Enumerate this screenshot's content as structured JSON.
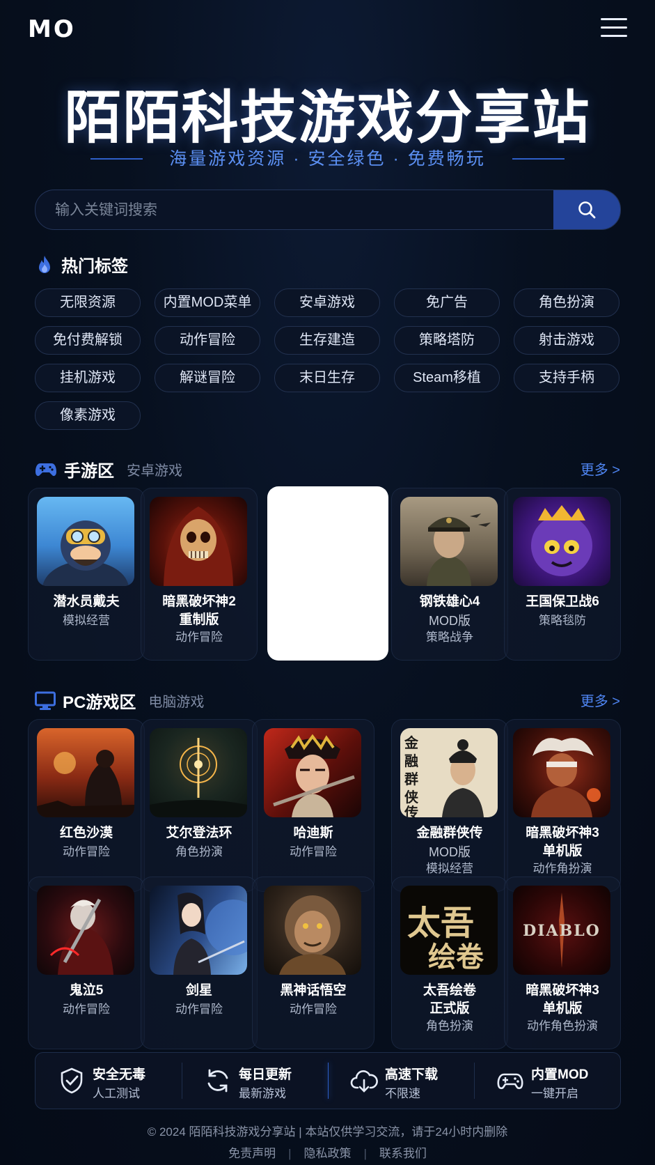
{
  "header": {
    "logo": "MO",
    "menu_icon": "hamburger-menu-icon"
  },
  "hero": {
    "title": "陌陌科技游戏分享站",
    "subtitle": "海量游戏资源 · 安全绿色 · 免费畅玩"
  },
  "search": {
    "placeholder": "输入关键词搜索",
    "icon": "search-icon"
  },
  "hot_tags": {
    "title": "热门标签",
    "icon": "flame-icon",
    "items": [
      "无限资源",
      "内置MOD菜单",
      "安卓游戏",
      "免广告",
      "角色扮演",
      "免付费解锁",
      "动作冒险",
      "生存建造",
      "策略塔防",
      "射击游戏",
      "挂机游戏",
      "解谜冒险",
      "末日生存",
      "Steam移植",
      "支持手柄",
      "像素游戏"
    ]
  },
  "mobile_section": {
    "title": "手游区",
    "subtitle": "安卓游戏",
    "more": "更多 >",
    "icon": "gamepad-icon",
    "cards": [
      {
        "name1": "潜水员戴夫",
        "name2": "",
        "genre": "模拟经营"
      },
      {
        "name1": "暗黑破坏神2",
        "name2": "重制版",
        "genre": "动作冒险"
      },
      {
        "name1": "",
        "name2": "",
        "genre": ""
      },
      {
        "name1": "钢铁雄心4",
        "name2": "MOD版",
        "genre": "策略战争"
      },
      {
        "name1": "王国保卫战6",
        "name2": "",
        "genre": "策略毯防"
      }
    ]
  },
  "pc_section": {
    "title": "PC游戏区",
    "subtitle": "电脑游戏",
    "more": "更多 >",
    "icon": "monitor-icon",
    "row1": [
      {
        "name1": "红色沙漠",
        "name2": "",
        "genre": "动作冒险"
      },
      {
        "name1": "艾尔登法环",
        "name2": "",
        "genre": "角色扮演"
      },
      {
        "name1": "哈迪斯",
        "name2": "",
        "genre": "动作冒险"
      },
      {
        "name1": "金融群侠传",
        "name2": "MOD版",
        "genre": "模拟经营"
      },
      {
        "name1": "暗黑破坏神3",
        "name2": "单机版",
        "genre": "动作角扮演"
      }
    ],
    "row2": [
      {
        "name1": "鬼泣5",
        "name2": "",
        "genre": "动作冒险"
      },
      {
        "name1": "剑星",
        "name2": "",
        "genre": "动作冒险"
      },
      {
        "name1": "黑神话悟空",
        "name2": "",
        "genre": "动作冒险"
      },
      {
        "name1": "太吾绘卷",
        "name2": "正式版",
        "genre": "角色扮演"
      },
      {
        "name1": "暗黑破坏神3",
        "name2": "单机版",
        "genre": "动作角色扮演"
      }
    ],
    "thumb_text": {
      "diablo": "DIABLO",
      "taiwu1": "太吾",
      "taiwu2": "绘卷",
      "jinrong": "金融群侠传"
    }
  },
  "features": [
    {
      "title": "安全无毒",
      "sub": "人工测试",
      "icon": "shield-check-icon"
    },
    {
      "title": "每日更新",
      "sub": "最新游戏",
      "icon": "refresh-icon"
    },
    {
      "title": "高速下载",
      "sub": "不限速",
      "icon": "cloud-download-icon"
    },
    {
      "title": "内置MOD",
      "sub": "一键开启",
      "icon": "controller-icon"
    }
  ],
  "footer": {
    "copyright": "© 2024  陌陌科技游戏分享站  |  本站仅供学习交流，请于24小时内删除",
    "links": [
      "免责声明",
      "隐私政策",
      "联系我们"
    ]
  },
  "colors": {
    "accent": "#4f86f3",
    "background": "#07101f",
    "search_button": "#24449a"
  }
}
